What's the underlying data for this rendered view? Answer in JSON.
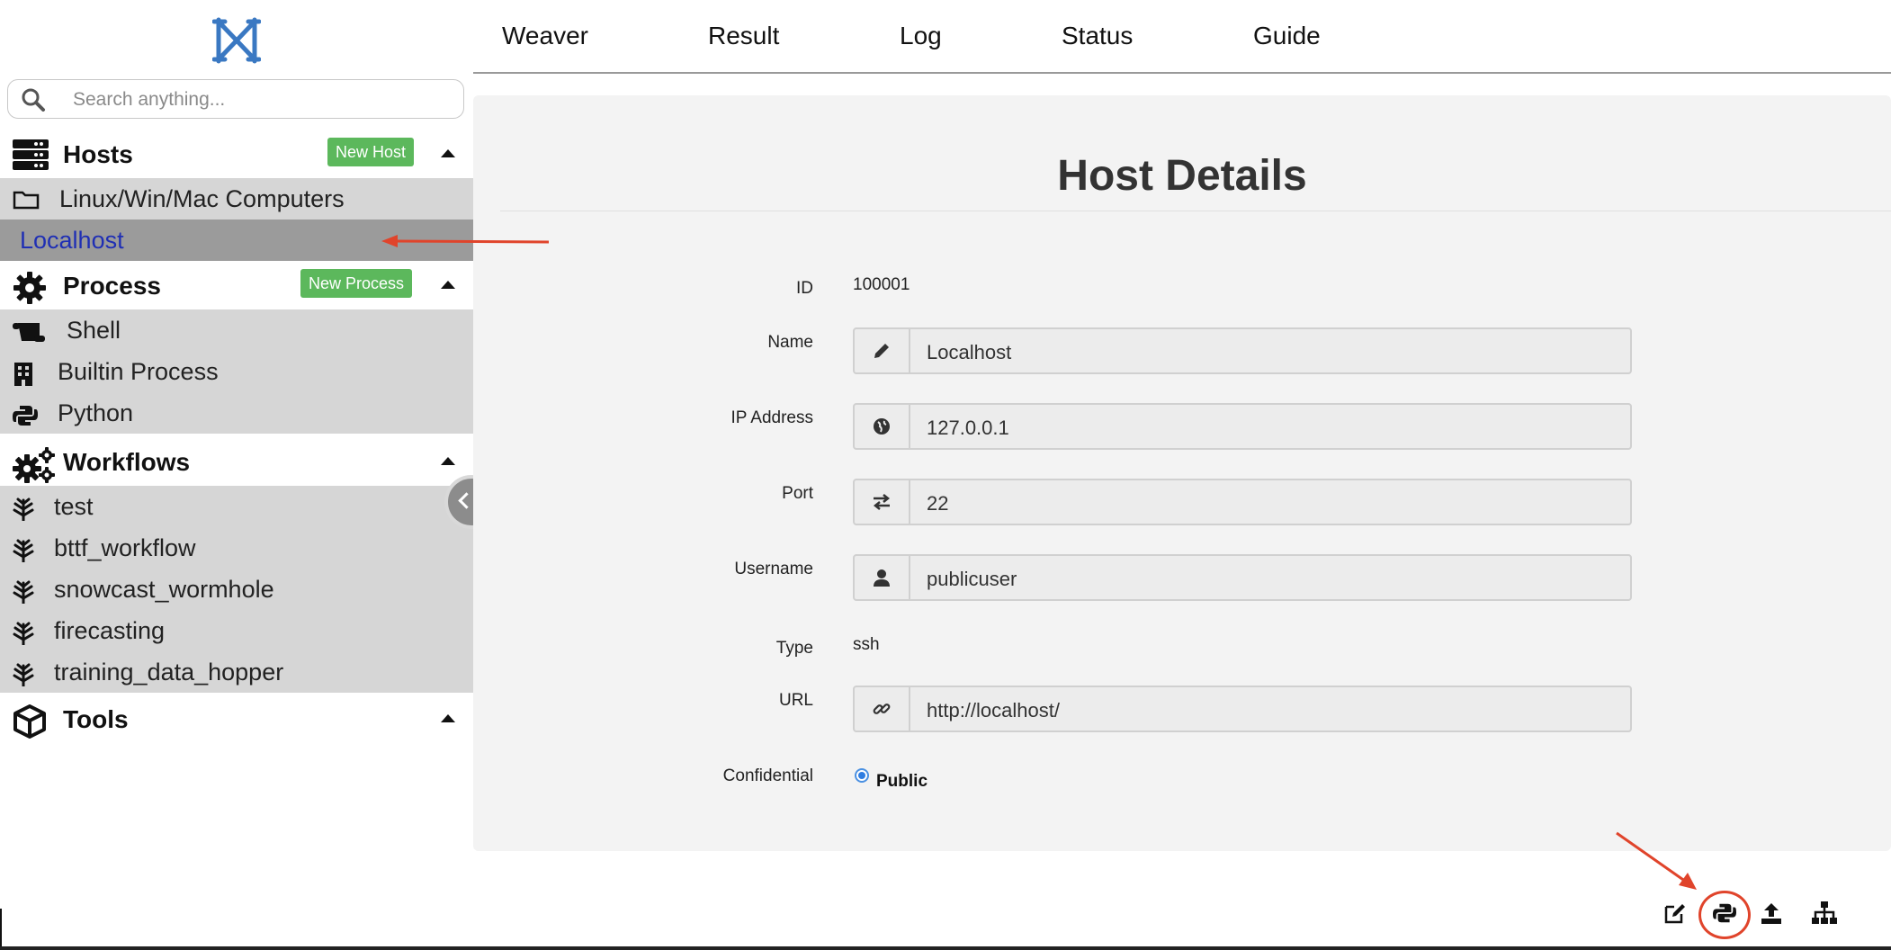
{
  "search": {
    "placeholder": "Search anything..."
  },
  "sidebar": {
    "hosts": {
      "title": "Hosts",
      "badge": "New Host",
      "items": [
        {
          "label": "Linux/Win/Mac Computers",
          "icon": "folder-icon"
        },
        {
          "label": "Localhost",
          "selected": true
        }
      ]
    },
    "process": {
      "title": "Process",
      "badge": "New Process",
      "items": [
        {
          "label": "Shell",
          "icon": "scroll-icon"
        },
        {
          "label": "Builtin Process",
          "icon": "building-icon"
        },
        {
          "label": "Python",
          "icon": "python-icon"
        }
      ]
    },
    "workflows": {
      "title": "Workflows",
      "items": [
        {
          "label": "test",
          "icon": "leaf-icon"
        },
        {
          "label": "bttf_workflow",
          "icon": "leaf-icon"
        },
        {
          "label": "snowcast_wormhole",
          "icon": "leaf-icon"
        },
        {
          "label": "firecasting",
          "icon": "leaf-icon"
        },
        {
          "label": "training_data_hopper",
          "icon": "leaf-icon"
        }
      ]
    },
    "tools": {
      "title": "Tools"
    }
  },
  "topnav": {
    "tabs": [
      "Weaver",
      "Result",
      "Log",
      "Status",
      "Guide"
    ]
  },
  "host": {
    "title": "Host Details",
    "fields": {
      "id": {
        "label": "ID",
        "value": "100001"
      },
      "name": {
        "label": "Name",
        "value": "Localhost",
        "icon": "pencil-icon"
      },
      "ip": {
        "label": "IP Address",
        "value": "127.0.0.1",
        "icon": "globe-icon"
      },
      "port": {
        "label": "Port",
        "value": "22",
        "icon": "arrows-exchange-icon"
      },
      "username": {
        "label": "Username",
        "value": "publicuser",
        "icon": "user-icon"
      },
      "type": {
        "label": "Type",
        "value": "ssh"
      },
      "url": {
        "label": "URL",
        "value": "http://localhost/",
        "icon": "link-icon"
      },
      "confidential": {
        "label": "Confidential",
        "option": "Public"
      }
    }
  },
  "toolbar": {
    "icons": [
      "edit-icon",
      "python-icon",
      "upload-icon",
      "sitemap-icon"
    ]
  },
  "colors": {
    "badge_green": "#5cb85c",
    "annotation_red": "#e0442b",
    "selected_link": "#1f2fb4",
    "logo_blue": "#3a78c2"
  }
}
